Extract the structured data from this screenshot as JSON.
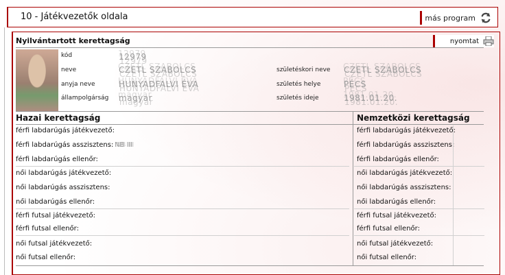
{
  "header": {
    "title": "10 - Játékvezetők oldala",
    "program_button": "más program"
  },
  "panel": {
    "title": "Nyilvántartott kerettagság",
    "print_button": "nyomtat"
  },
  "person": {
    "code_label": "kód",
    "code_value": "12979",
    "name_label": "neve",
    "name_value": "CZETL SZABOLCS",
    "mother_label": "anyja neve",
    "mother_value": "HUNYADFALVI ÉVA",
    "citizenship_label": "állampolgárság",
    "citizenship_value": "magyar",
    "birthname_label": "születéskori neve",
    "birthname_value": "CZETL SZABOLCS",
    "birthplace_label": "születés helye",
    "birthplace_value": "PÉCS",
    "birthdate_label": "születés ideje",
    "birthdate_value": "1981.01.20."
  },
  "domestic": {
    "title": "Hazai kerettagság",
    "rows": [
      {
        "label": "férfi labdarúgás játékvezető:",
        "value": ""
      },
      {
        "label": "férfi labdarúgás asszisztens:",
        "value": "NB III"
      },
      {
        "label": "férfi labdarúgás ellenőr:",
        "value": ""
      },
      {
        "label": "női labdarúgás játékvezető:",
        "value": ""
      },
      {
        "label": "női labdarúgás asszisztens:",
        "value": ""
      },
      {
        "label": "női labdarúgás ellenőr:",
        "value": ""
      },
      {
        "label": "férfi futsal játékvezető:",
        "value": ""
      },
      {
        "label": "férfi futsal ellenőr:",
        "value": ""
      },
      {
        "label": "női futsal játékvezető:",
        "value": ""
      },
      {
        "label": "női futsal ellenőr:",
        "value": ""
      }
    ]
  },
  "international": {
    "title": "Nemzetközi kerettagság",
    "rows": [
      {
        "label": "férfi labdarúgás játékvezető:"
      },
      {
        "label": "férfi labdarúgás asszisztens:"
      },
      {
        "label": "férfi labdarúgás ellenőr:"
      },
      {
        "label": "női labdarúgás játékvezető:"
      },
      {
        "label": "női labdarúgás asszisztens:"
      },
      {
        "label": "női labdarúgás ellenőr:"
      },
      {
        "label": "férfi futsal játékvezető:"
      },
      {
        "label": "férfi futsal ellenőr:"
      },
      {
        "label": "női futsal játékvezető:"
      },
      {
        "label": "női futsal ellenőr:"
      }
    ]
  },
  "colors": {
    "accent": "#aa0000"
  }
}
